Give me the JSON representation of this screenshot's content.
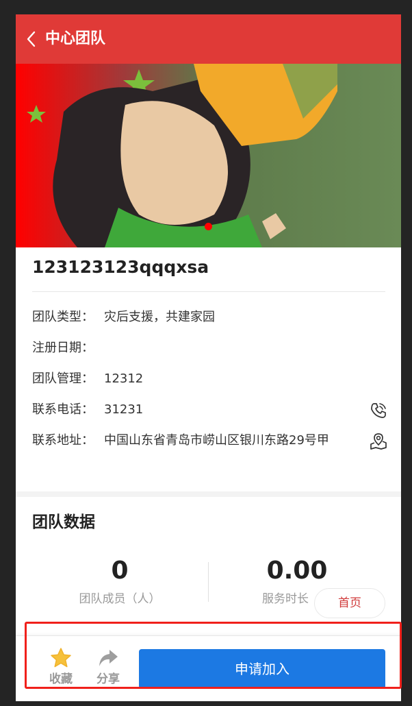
{
  "header": {
    "title": "中心团队"
  },
  "banner": {
    "slide_count": 1,
    "active_slide": 1,
    "accent_color": "#ff0000"
  },
  "team": {
    "name": "123123123qqqxsa"
  },
  "info": [
    {
      "label": "团队类型：",
      "value": "灾后支援，共建家园"
    },
    {
      "label": "注册日期：",
      "value": ""
    },
    {
      "label": "团队管理：",
      "value": "12312"
    },
    {
      "label": "联系电话：",
      "value": "31231"
    },
    {
      "label": "联系地址：",
      "value": "中国山东省青岛市崂山区银川东路29号甲"
    }
  ],
  "stats": {
    "title": "团队数据",
    "members": {
      "value": "0",
      "label": "团队成员（人）"
    },
    "hours": {
      "value": "0.00",
      "label": "服务时长（小"
    }
  },
  "floating": {
    "home_label": "首页"
  },
  "bottom_bar": {
    "favorite_label": "收藏",
    "share_label": "分享",
    "join_label": "申请加入"
  },
  "colors": {
    "header_bg": "#e03a37",
    "primary_button": "#1c79e3",
    "star": "#f6c13b",
    "highlight_border": "#f0201b"
  }
}
